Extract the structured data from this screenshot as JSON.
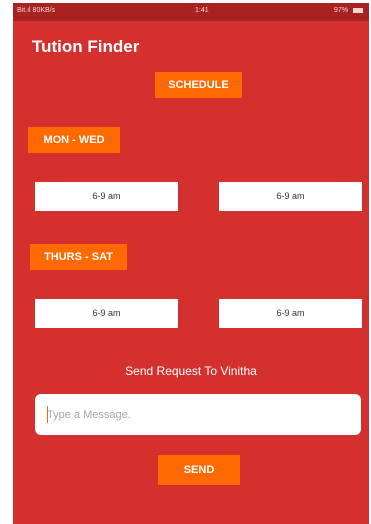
{
  "status_bar": {
    "left": "Bit.ıl 80KB/s",
    "center": "1:41",
    "right": "97%"
  },
  "app": {
    "title": "Tution Finder"
  },
  "schedule_button": {
    "label": "SCHEDULE"
  },
  "groups": [
    {
      "label": "MON - WED",
      "times": [
        "6-9 am",
        "6-9 am"
      ]
    },
    {
      "label": "THURS - SAT",
      "times": [
        "6-9 am",
        "6-9 am"
      ]
    }
  ],
  "request": {
    "text": "Send Request To Vinitha"
  },
  "message": {
    "placeholder": "Type a Message.",
    "value": ""
  },
  "send_button": {
    "label": "SEND"
  },
  "colors": {
    "background": "#d3302e",
    "status_bar": "#a92121",
    "accent": "#ff6a00",
    "text": "#ffffff"
  }
}
